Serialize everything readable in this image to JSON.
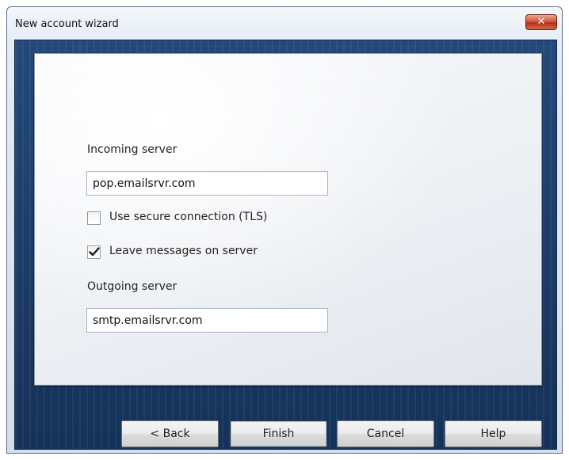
{
  "window": {
    "title": "New account wizard",
    "close_label": "✕"
  },
  "form": {
    "incoming_label": "Incoming server",
    "incoming_value": "pop.emailsrvr.com",
    "tls_label": "Use secure connection (TLS)",
    "tls_checked": false,
    "leave_label": "Leave messages on server",
    "leave_checked": true,
    "outgoing_label": "Outgoing server",
    "outgoing_value": "smtp.emailsrvr.com"
  },
  "buttons": {
    "back": "< Back",
    "finish": "Finish",
    "cancel": "Cancel",
    "help": "Help"
  },
  "colors": {
    "client_background": "#1c3d69",
    "close_button": "#c7462c"
  }
}
